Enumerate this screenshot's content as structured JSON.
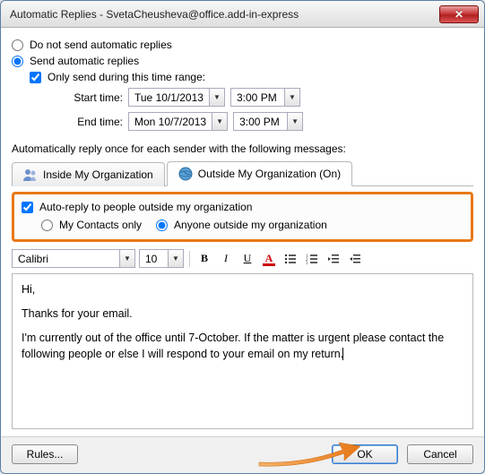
{
  "title": "Automatic Replies - SvetaCheusheva@office.add-in-express",
  "options": {
    "do_not_send": "Do not send automatic replies",
    "send": "Send automatic replies",
    "only_range": "Only send during this time range:",
    "start_label": "Start time:",
    "start_date": "Tue 10/1/2013",
    "start_time": "3:00 PM",
    "end_label": "End time:",
    "end_date": "Mon 10/7/2013",
    "end_time": "3:00 PM"
  },
  "auto_msg_label": "Automatically reply once for each sender with the following messages:",
  "tabs": {
    "inside": "Inside My Organization",
    "outside": "Outside My Organization (On)"
  },
  "outside": {
    "autoreply": "Auto-reply to people outside my organization",
    "contacts_only": "My Contacts only",
    "anyone": "Anyone outside my organization"
  },
  "fmt": {
    "font": "Calibri",
    "size": "10"
  },
  "body": {
    "greeting": "Hi,",
    "thanks": "Thanks for your email.",
    "message": "I'm currently out of the office until 7-October. If the matter is urgent please contact the following people or else I will respond to your email on my return."
  },
  "buttons": {
    "rules": "Rules...",
    "ok": "OK",
    "cancel": "Cancel"
  }
}
